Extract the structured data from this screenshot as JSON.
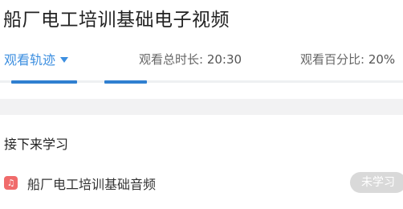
{
  "header": {
    "title": "船厂电工培训基础电子视频"
  },
  "stats": {
    "track_label": "观看轨迹",
    "total_label": "观看总时长: ",
    "total_value": "20:30",
    "percent_label": "观看百分比: ",
    "percent_value": "20%"
  },
  "next": {
    "heading": "接下来学习",
    "items": [
      {
        "icon": "music-note-icon",
        "title": "船厂电工培训基础音频",
        "status": "未学习"
      }
    ]
  },
  "colors": {
    "accent": "#3d8fe0",
    "audio_icon": "#f06b6b",
    "badge_bg": "#d9d9d9"
  }
}
